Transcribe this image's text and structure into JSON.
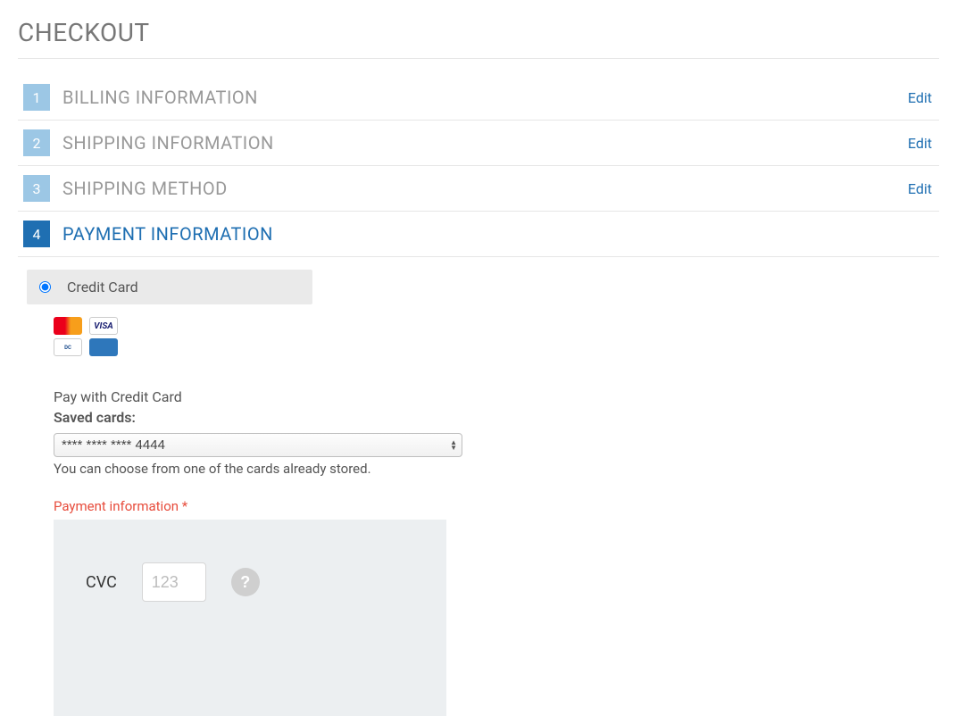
{
  "page": {
    "title": "CHECKOUT"
  },
  "steps": [
    {
      "num": "1",
      "title": "BILLING INFORMATION",
      "edit": "Edit",
      "active": false
    },
    {
      "num": "2",
      "title": "SHIPPING INFORMATION",
      "edit": "Edit",
      "active": false
    },
    {
      "num": "3",
      "title": "SHIPPING METHOD",
      "edit": "Edit",
      "active": false
    },
    {
      "num": "4",
      "title": "PAYMENT INFORMATION",
      "edit": "",
      "active": true
    }
  ],
  "payment": {
    "method_label": "Credit Card",
    "logos": [
      "mastercard",
      "diners-club",
      "visa",
      "amex"
    ],
    "pay_heading": "Pay with Credit Card",
    "saved_cards_label": "Saved cards:",
    "saved_card_selected": "**** **** **** 4444",
    "saved_help": "You can choose from one of the cards already stored.",
    "error_label": "Payment information *",
    "cvc_label": "CVC",
    "cvc_placeholder": "123",
    "help_button": "?"
  },
  "colors": {
    "accent": "#1f6fb2",
    "accent_light": "#9cc7e5",
    "error": "#e74c3c"
  }
}
